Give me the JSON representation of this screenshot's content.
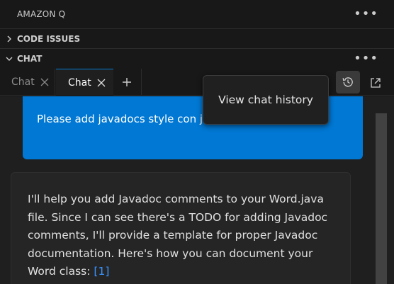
{
  "panel": {
    "title": "AMAZON Q"
  },
  "sections": {
    "code_issues": {
      "label": "CODE ISSUES"
    },
    "chat": {
      "label": "CHAT"
    }
  },
  "tabs": [
    {
      "label": "Chat",
      "active": false
    },
    {
      "label": "Chat",
      "active": true
    }
  ],
  "icons": {
    "more": "ellipsis-icon",
    "history": "history-icon",
    "external": "open-external-icon",
    "add": "plus-icon",
    "close": "close-icon"
  },
  "tooltip": {
    "text": "View chat history"
  },
  "messages": {
    "user": {
      "text": "Please add javadocs style con                    java file"
    },
    "assistant": {
      "text": "I'll help you add Javadoc comments to your Word.java file. Since I can see there's a TODO for adding Javadoc comments, I'll provide a template for proper Javadoc documentation. Here's how you can document your Word class: ",
      "reference": "[1]"
    }
  },
  "colors": {
    "accent": "#0078d4",
    "link": "#3794ff",
    "background": "#181818",
    "editor": "#1f1f1f"
  }
}
